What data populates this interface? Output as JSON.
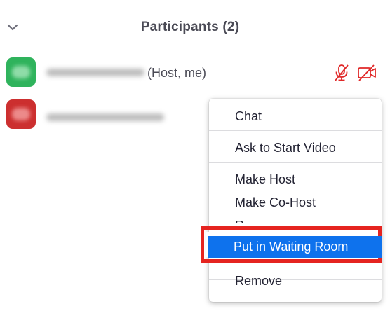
{
  "panel": {
    "title": "Participants (2)",
    "collapse_icon": "chevron-down-icon"
  },
  "participants": [
    {
      "avatar_color": "#2fb35c",
      "name_suffix": "(Host, me)",
      "icons": [
        "mic-muted-icon",
        "video-off-icon"
      ]
    },
    {
      "avatar_color": "#cc2f2f",
      "name_suffix": ""
    }
  ],
  "context_menu": {
    "items": [
      {
        "label": "Chat"
      },
      {
        "label": "Ask to Start Video"
      },
      {
        "label": "Make Host"
      },
      {
        "label": "Make Co-Host"
      },
      {
        "label": "Rename"
      },
      {
        "label": "Put in Waiting Room",
        "highlighted": true
      },
      {
        "label": "Remove"
      }
    ]
  },
  "colors": {
    "accent": "#0e72ed",
    "annotation": "#e52420",
    "muted_icon": "#e02828"
  }
}
